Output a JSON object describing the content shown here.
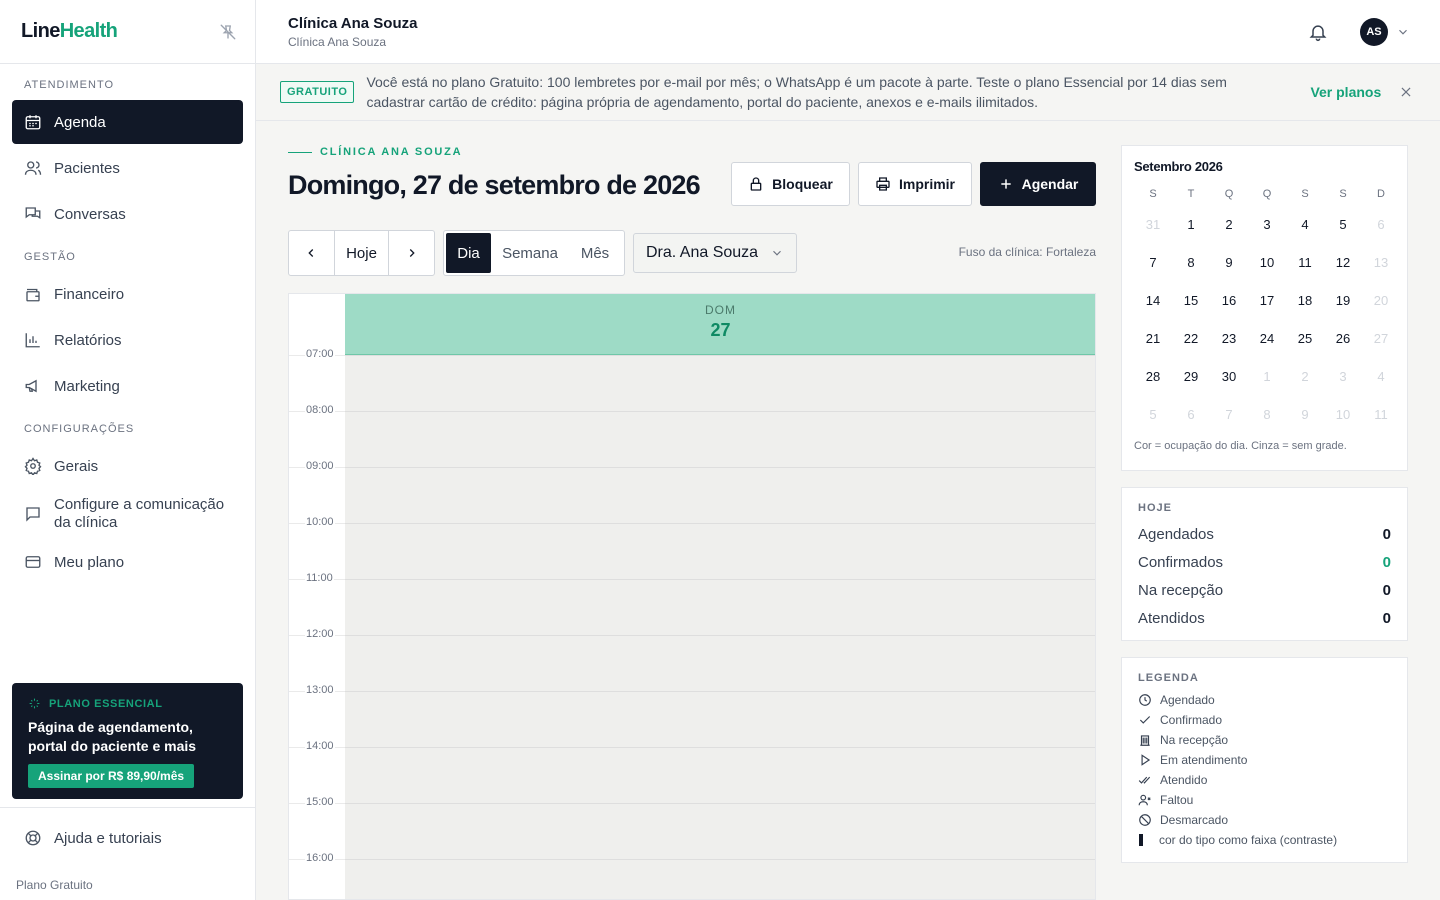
{
  "app": {
    "logo_line": "Line",
    "logo_health": "Health"
  },
  "sidebar": {
    "sections": [
      "ATENDIMENTO",
      "GESTÃO",
      "CONFIGURAÇÕES"
    ],
    "items": [
      {
        "label": "Agenda",
        "icon": "calendar-icon"
      },
      {
        "label": "Pacientes",
        "icon": "users-icon"
      },
      {
        "label": "Conversas",
        "icon": "chat-icon"
      },
      {
        "label": "Financeiro",
        "icon": "wallet-icon"
      },
      {
        "label": "Relatórios",
        "icon": "bar-chart-icon"
      },
      {
        "label": "Marketing",
        "icon": "megaphone-icon"
      },
      {
        "label": "Gerais",
        "icon": "gear-icon"
      },
      {
        "label": "Configure a comunicação da clínica",
        "icon": "message-icon"
      },
      {
        "label": "Meu plano",
        "icon": "credit-card-icon"
      }
    ],
    "promo": {
      "tag": "PLANO ESSENCIAL",
      "title": "Página de agendamento, portal do paciente e mais",
      "button": "Assinar por R$ 89,90/mês"
    },
    "help": "Ajuda e tutoriais",
    "plan_footer": "Plano Gratuito"
  },
  "topbar": {
    "clinic_name": "Clínica Ana Souza",
    "clinic_sub": "Clínica Ana Souza",
    "avatar_initials": "AS"
  },
  "banner": {
    "badge": "GRATUITO",
    "text": "Você está no plano Gratuito: 100 lembretes por e-mail por mês; o WhatsApp é um pacote à parte. Teste o plano Essencial por 14 dias sem cadastrar cartão de crédito: página própria de agendamento, portal do paciente, anexos e e-mails ilimitados.",
    "link": "Ver planos"
  },
  "main": {
    "eyebrow": "CLÍNICA ANA SOUZA",
    "title": "Domingo, 27 de setembro de 2026",
    "buttons": {
      "block": "Bloquear",
      "print": "Imprimir",
      "schedule": "Agendar"
    },
    "today": "Hoje",
    "views": {
      "day": "Dia",
      "week": "Semana",
      "month": "Mês",
      "selected": "Dia"
    },
    "doctor": "Dra. Ana Souza",
    "timezone": "Fuso da clínica: Fortaleza"
  },
  "calendar": {
    "day_of_week": "DOM",
    "day_number": "27",
    "hours": [
      "07:00",
      "08:00",
      "09:00",
      "10:00",
      "11:00",
      "12:00",
      "13:00",
      "14:00",
      "15:00",
      "16:00"
    ]
  },
  "mini_calendar": {
    "title": "Setembro 2026",
    "weekdays": [
      "S",
      "T",
      "Q",
      "Q",
      "S",
      "S",
      "D"
    ],
    "days": [
      {
        "d": "31",
        "m": true
      },
      {
        "d": "1"
      },
      {
        "d": "2"
      },
      {
        "d": "3"
      },
      {
        "d": "4"
      },
      {
        "d": "5"
      },
      {
        "d": "6",
        "m": true
      },
      {
        "d": "7"
      },
      {
        "d": "8"
      },
      {
        "d": "9"
      },
      {
        "d": "10"
      },
      {
        "d": "11"
      },
      {
        "d": "12"
      },
      {
        "d": "13",
        "m": true
      },
      {
        "d": "14"
      },
      {
        "d": "15"
      },
      {
        "d": "16"
      },
      {
        "d": "17"
      },
      {
        "d": "18"
      },
      {
        "d": "19"
      },
      {
        "d": "20",
        "m": true
      },
      {
        "d": "21"
      },
      {
        "d": "22"
      },
      {
        "d": "23"
      },
      {
        "d": "24"
      },
      {
        "d": "25"
      },
      {
        "d": "26"
      },
      {
        "d": "27",
        "m": true
      },
      {
        "d": "28"
      },
      {
        "d": "29"
      },
      {
        "d": "30"
      },
      {
        "d": "1",
        "m": true
      },
      {
        "d": "2",
        "m": true
      },
      {
        "d": "3",
        "m": true
      },
      {
        "d": "4",
        "m": true
      },
      {
        "d": "5",
        "m": true
      },
      {
        "d": "6",
        "m": true
      },
      {
        "d": "7",
        "m": true
      },
      {
        "d": "8",
        "m": true
      },
      {
        "d": "9",
        "m": true
      },
      {
        "d": "10",
        "m": true
      },
      {
        "d": "11",
        "m": true
      }
    ],
    "note": "Cor = ocupação do dia. Cinza = sem grade."
  },
  "today_stats": {
    "heading": "HOJE",
    "rows": [
      {
        "label": "Agendados",
        "value": "0"
      },
      {
        "label": "Confirmados",
        "value": "0"
      },
      {
        "label": "Na recepção",
        "value": "0"
      },
      {
        "label": "Atendidos",
        "value": "0"
      }
    ]
  },
  "legend": {
    "heading": "LEGENDA",
    "items": [
      {
        "label": "Agendado",
        "icon": "clock-icon"
      },
      {
        "label": "Confirmado",
        "icon": "check-icon"
      },
      {
        "label": "Na recepção",
        "icon": "building-icon"
      },
      {
        "label": "Em atendimento",
        "icon": "play-icon"
      },
      {
        "label": "Atendido",
        "icon": "double-check-icon"
      },
      {
        "label": "Faltou",
        "icon": "user-x-icon"
      },
      {
        "label": "Desmarcado",
        "icon": "ban-icon"
      },
      {
        "label": "cor do tipo como faixa (contraste)",
        "icon": "color-bar-icon"
      }
    ]
  },
  "colors": {
    "accent": "#16a37a",
    "dark": "#111827",
    "day_header": "#9edbc6"
  }
}
